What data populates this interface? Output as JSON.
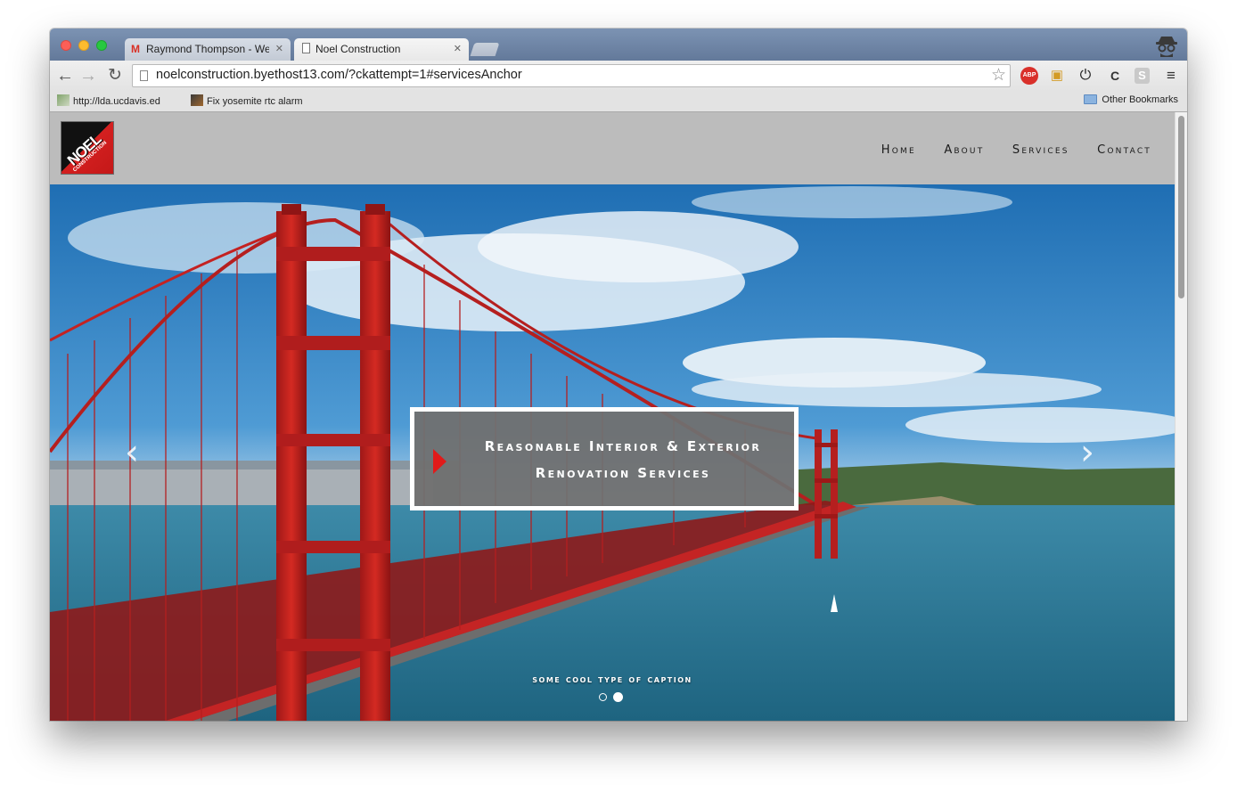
{
  "browser": {
    "tabs": [
      {
        "label": "Raymond Thompson - Web",
        "active": false,
        "icon": "gmail-icon"
      },
      {
        "label": "Noel Construction",
        "active": true,
        "icon": "page-icon"
      }
    ],
    "url": "noelconstruction.byethost13.com/?ckattempt=1#servicesAnchor",
    "bookmarks": [
      {
        "label": "http://lda.ucdavis.ed"
      },
      {
        "label": "Fix yosemite rtc alarm"
      }
    ],
    "other_bookmarks": "Other Bookmarks",
    "extensions": [
      "abp-icon",
      "package-icon",
      "power-icon",
      "cookie-icon",
      "s-icon",
      "menu-icon"
    ],
    "abp_label": "ABP",
    "s_label": "S"
  },
  "site": {
    "logo_text": "NOEL",
    "logo_sub": "CONSTRUCTION",
    "nav": [
      "Home",
      "About",
      "Services",
      "Contact"
    ],
    "hero": {
      "caption_line1": "Reasonable Interior & Exterior",
      "caption_line2": "Renovation Services",
      "slide_caption": "some cool type of caption",
      "slides_total": 2,
      "active_slide": 2
    }
  },
  "colors": {
    "accent_red": "#e11a1a",
    "header_gray": "#bcbcbc",
    "caption_box": "#707070"
  }
}
